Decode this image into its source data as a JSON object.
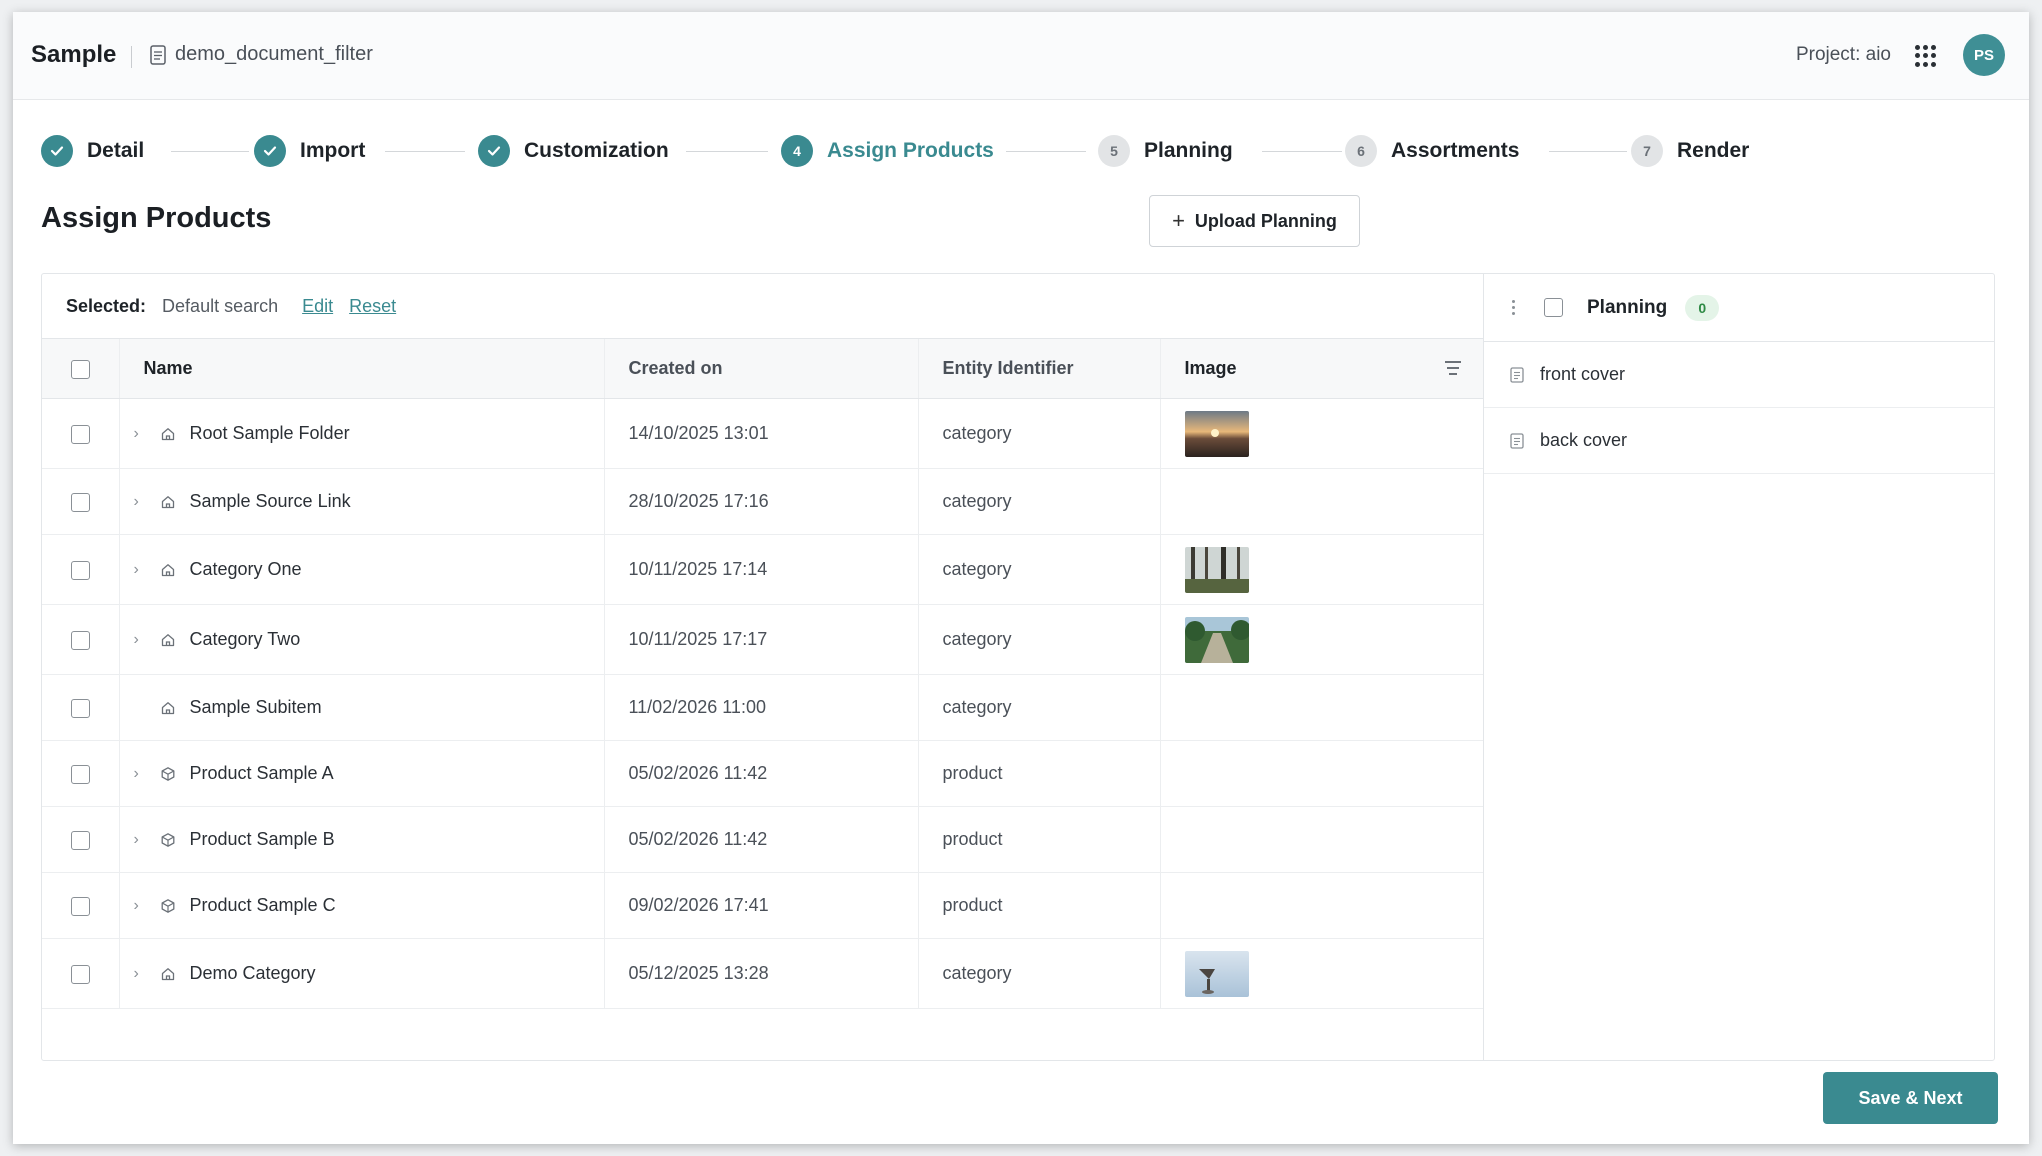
{
  "header": {
    "brand": "Sample",
    "document_name": "demo_document_filter",
    "project": "Project: aio",
    "avatar_initials": "PS"
  },
  "stepper": [
    {
      "number": "1",
      "label": "Detail",
      "state": "done"
    },
    {
      "number": "2",
      "label": "Import",
      "state": "done"
    },
    {
      "number": "3",
      "label": "Customization",
      "state": "done"
    },
    {
      "number": "4",
      "label": "Assign Products",
      "state": "active"
    },
    {
      "number": "5",
      "label": "Planning",
      "state": "todo"
    },
    {
      "number": "6",
      "label": "Assortments",
      "state": "todo"
    },
    {
      "number": "7",
      "label": "Render",
      "state": "todo"
    }
  ],
  "page_title": "Assign Products",
  "upload_button": "Upload Planning",
  "selection": {
    "label": "Selected:",
    "value": "Default search",
    "edit": "Edit",
    "reset": "Reset"
  },
  "table": {
    "columns": [
      "Name",
      "Created on",
      "Entity Identifier",
      "Image"
    ],
    "rows": [
      {
        "name": "Root Sample Folder",
        "created": "14/10/2025 13:01",
        "entity": "category",
        "icon": "home-icon",
        "expandable": true,
        "image": "sunset"
      },
      {
        "name": "Sample Source Link",
        "created": "28/10/2025 17:16",
        "entity": "category",
        "icon": "home-icon",
        "expandable": true,
        "image": ""
      },
      {
        "name": "Category One",
        "created": "10/11/2025 17:14",
        "entity": "category",
        "icon": "home-icon",
        "expandable": true,
        "image": "forest"
      },
      {
        "name": "Category Two",
        "created": "10/11/2025 17:17",
        "entity": "category",
        "icon": "home-icon",
        "expandable": true,
        "image": "path"
      },
      {
        "name": "Sample Subitem",
        "created": "11/02/2026 11:00",
        "entity": "category",
        "icon": "home-icon",
        "expandable": false,
        "image": ""
      },
      {
        "name": "Product Sample A",
        "created": "05/02/2026 11:42",
        "entity": "product",
        "icon": "box-icon",
        "expandable": true,
        "image": ""
      },
      {
        "name": "Product Sample B",
        "created": "05/02/2026 11:42",
        "entity": "product",
        "icon": "box-icon",
        "expandable": true,
        "image": ""
      },
      {
        "name": "Product Sample C",
        "created": "09/02/2026 17:41",
        "entity": "product",
        "icon": "box-icon",
        "expandable": true,
        "image": ""
      },
      {
        "name": "Demo Category",
        "created": "05/12/2025 13:28",
        "entity": "category",
        "icon": "home-icon",
        "expandable": true,
        "image": "sky"
      }
    ]
  },
  "planning": {
    "title": "Planning",
    "count": "0",
    "items": [
      "front cover",
      "back cover"
    ]
  },
  "save_button": "Save & Next",
  "colors": {
    "accent": "#3a8a90",
    "badge_bg": "#e4f4e8",
    "badge_text": "#2e8a45"
  }
}
